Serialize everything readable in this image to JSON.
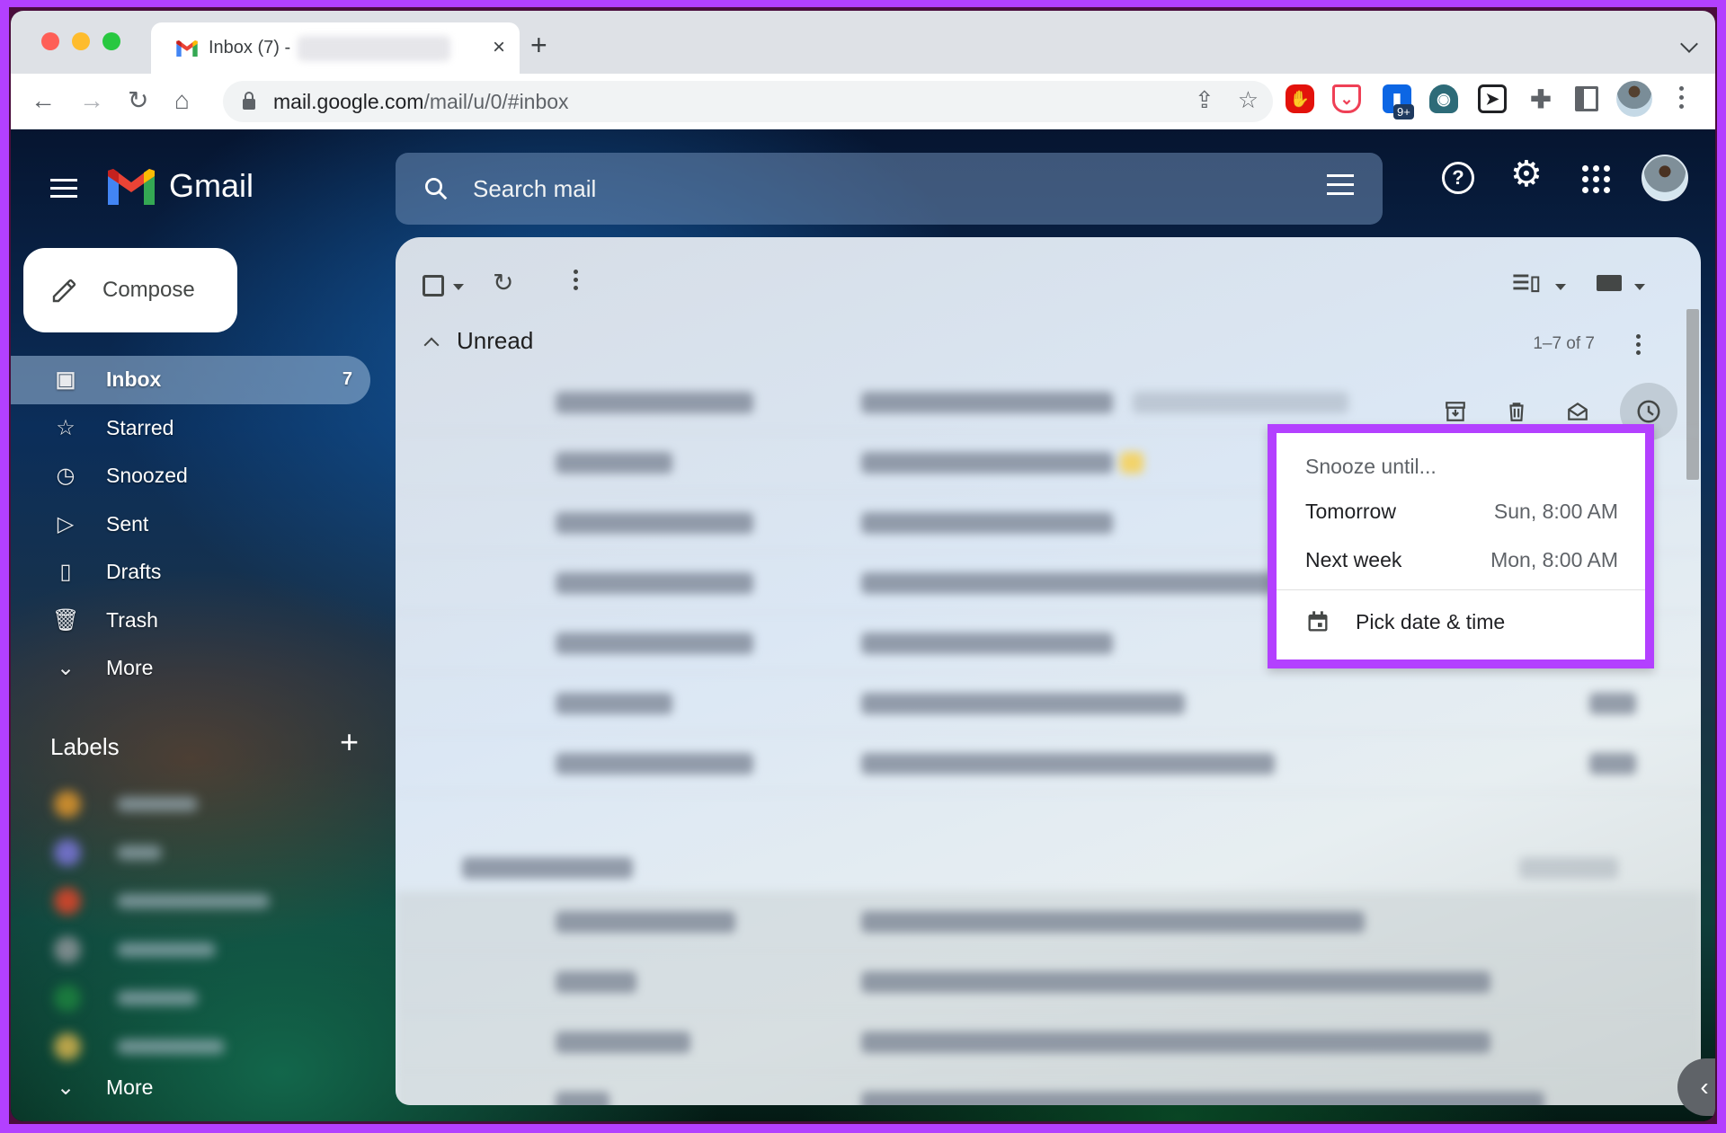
{
  "browser": {
    "tab_title": "Inbox (7) -",
    "url_domain": "mail.google.com",
    "url_path": "/mail/u/0/#inbox",
    "extension_badge": "9+"
  },
  "gmail": {
    "brand": "Gmail",
    "compose_label": "Compose",
    "search": {
      "placeholder": "Search mail"
    },
    "nav": [
      {
        "label": "Inbox",
        "icon": "inbox-icon",
        "count": "7",
        "active": true
      },
      {
        "label": "Starred",
        "icon": "star-icon"
      },
      {
        "label": "Snoozed",
        "icon": "clock-icon"
      },
      {
        "label": "Sent",
        "icon": "send-icon"
      },
      {
        "label": "Drafts",
        "icon": "draft-icon"
      },
      {
        "label": "Trash",
        "icon": "trash-icon"
      },
      {
        "label": "More",
        "icon": "chevron-down-icon"
      }
    ],
    "labels_heading": "Labels",
    "labels": [
      {
        "color": "#c68a2e"
      },
      {
        "color": "#6f6fc4"
      },
      {
        "color": "#c5452c"
      },
      {
        "color": "#7b8a8c"
      },
      {
        "color": "#1b7a3e"
      },
      {
        "color": "#b9a44a"
      }
    ],
    "labels_more": "More",
    "section": {
      "title": "Unread",
      "pager": "1–7 of 7"
    },
    "snooze_menu": {
      "title": "Snooze until...",
      "options": [
        {
          "label": "Tomorrow",
          "time": "Sun, 8:00 AM"
        },
        {
          "label": "Next week",
          "time": "Mon, 8:00 AM"
        }
      ],
      "pick_label": "Pick date & time"
    },
    "colors": {
      "highlight": "#b340ff",
      "active_nav": "#a0bedc"
    }
  }
}
